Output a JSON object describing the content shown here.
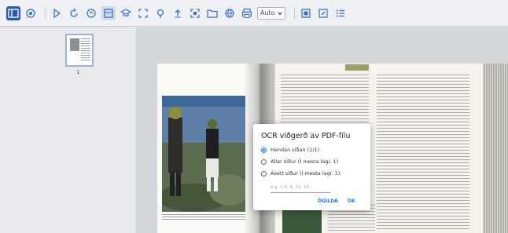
{
  "toolbar": {
    "zoom_value": "Auto",
    "icons": [
      "sidebar-toggle-icon",
      "layers-icon",
      "play-icon",
      "rotate-icon",
      "sync-icon",
      "view-mode-icon",
      "presentation-icon",
      "expand-icon",
      "pin-icon",
      "upload-icon",
      "scan-icon",
      "folder-icon",
      "globe-icon",
      "print-icon",
      "thumbnails-icon",
      "edit-icon",
      "list-icon"
    ]
  },
  "thumbnail": {
    "page_number": "1"
  },
  "dialog": {
    "title": "OCR viðgerð av PDF-fílu",
    "options": [
      {
        "label": "Hendan síðan (1/1)",
        "checked": true
      },
      {
        "label": "Allar síður (Í mesta lagi. 1)",
        "checked": false
      },
      {
        "label": "Ásett síður (Í mesta lagi. 1):",
        "checked": false
      }
    ],
    "range_placeholder": "e.g. 1-5, 8, 11, 13",
    "cancel_label": "ÓGILDA",
    "ok_label": "OK"
  },
  "colors": {
    "accent": "#1a73e8",
    "toolbar_bg": "#eef0f3"
  }
}
